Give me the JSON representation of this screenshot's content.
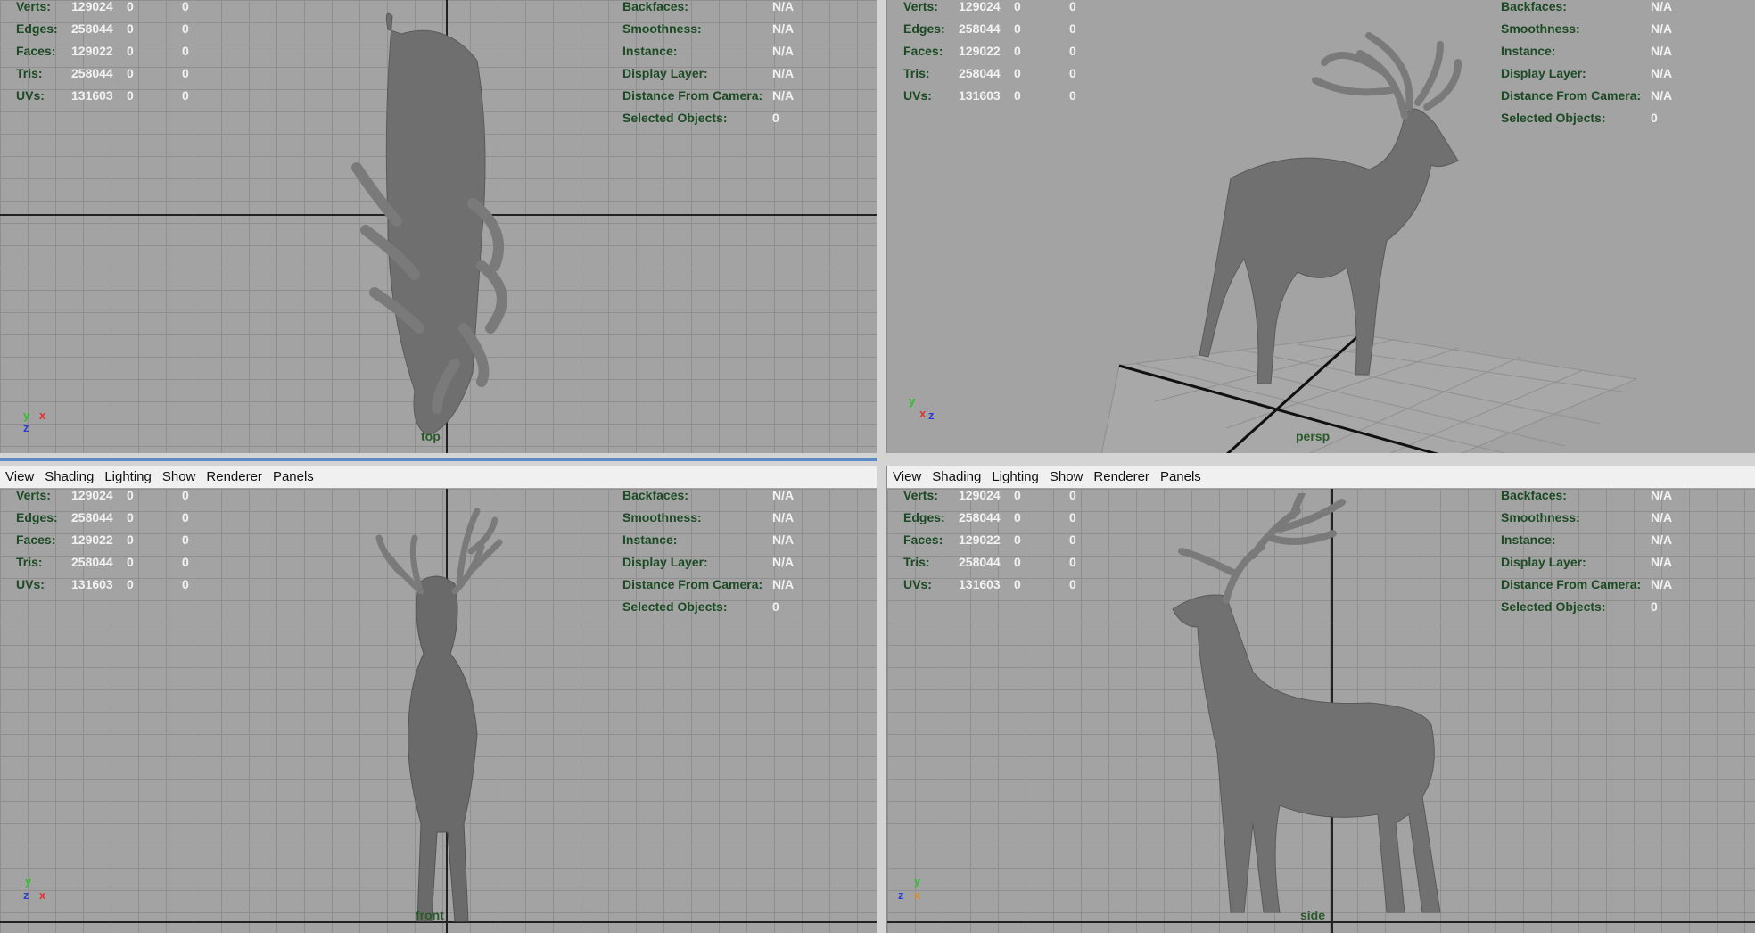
{
  "menu": [
    "View",
    "Shading",
    "Lighting",
    "Show",
    "Renderer",
    "Panels"
  ],
  "hud_left": {
    "labels": [
      "Verts:",
      "Edges:",
      "Faces:",
      "Tris:",
      "UVs:"
    ],
    "values": [
      [
        "129024",
        "0",
        "0"
      ],
      [
        "258044",
        "0",
        "0"
      ],
      [
        "129022",
        "0",
        "0"
      ],
      [
        "258044",
        "0",
        "0"
      ],
      [
        "131603",
        "0",
        "0"
      ]
    ]
  },
  "hud_right": {
    "labels": [
      "Backfaces:",
      "Smoothness:",
      "Instance:",
      "Display Layer:",
      "Distance From Camera:",
      "Selected Objects:"
    ],
    "values": [
      "N/A",
      "N/A",
      "N/A",
      "N/A",
      "N/A",
      "0"
    ]
  },
  "cameras": {
    "top": "top",
    "persp": "persp",
    "front": "front",
    "side": "side"
  },
  "colors": {
    "viewport_bg": "#a3a3a3",
    "hud_label": "#1b4a24",
    "hud_value": "#f2f2f2",
    "active_border": "#5d8ac4"
  }
}
